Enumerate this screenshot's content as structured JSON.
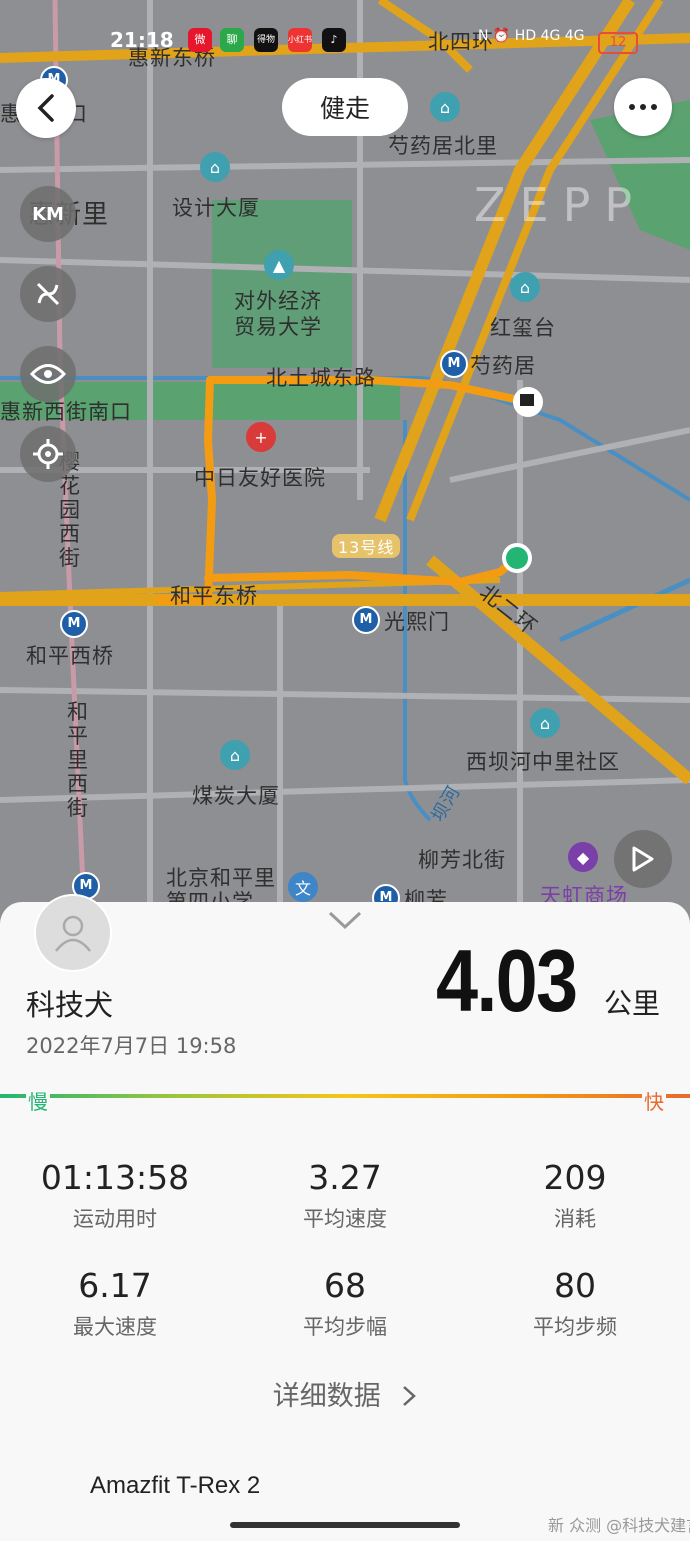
{
  "status_bar": {
    "time": "21:18",
    "apps": [
      "微",
      "聊",
      "得物",
      "小红书",
      "♪"
    ],
    "system": "N ⏰ HD 4G 4G",
    "battery": "12"
  },
  "map": {
    "watermark": "ZEPP",
    "labels": {
      "huixin_dongqiao": "惠新东桥",
      "beisihuan": "北四环",
      "huixin_beikou": "惠新北口",
      "huixin_li": "惠新里",
      "shaoyaoju_beili": "芍药居北里",
      "sheji_dasha": "设计大厦",
      "uibe": "对外经济\n贸易大学",
      "hongxi_tai": "红玺台",
      "shaoyaoju": "芍药居",
      "beitucheng_donglu": "北土城东路",
      "huixin_xijie_nankou": "惠新西街南口",
      "yinghua_yuan_xijie": "樱花园西街",
      "zhongri_hospital": "中日友好医院",
      "line13": "13号线",
      "heping_dongqiao": "和平东桥",
      "guangximen": "光熙门",
      "beierhuan": "北二环",
      "heping_xiqiao": "和平西桥",
      "heping_li_xijie": "和平里西街",
      "meitan_dasha": "煤炭大厦",
      "xibahe": "西坝河中里社区",
      "bahe": "坝河",
      "liufang_beijie": "柳芳北街",
      "beijing_hepingli": "北京和平里\n第四小学",
      "liufang": "柳芳",
      "tianhong": "天虹商场"
    }
  },
  "controls": {
    "mode": "健走",
    "km_icon": "KM"
  },
  "workout": {
    "username": "科技犬",
    "datetime": "2022年7月7日 19:58",
    "distance": "4.03",
    "distance_unit": "公里",
    "slow_label": "慢",
    "fast_label": "快",
    "stats": [
      {
        "value": "01:13:58",
        "label": "运动用时"
      },
      {
        "value": "3.27",
        "label": "平均速度"
      },
      {
        "value": "209",
        "label": "消耗"
      },
      {
        "value": "6.17",
        "label": "最大速度"
      },
      {
        "value": "68",
        "label": "平均步幅"
      },
      {
        "value": "80",
        "label": "平均步频"
      }
    ],
    "detail_link": "详细数据",
    "device": "Amazfit T-Rex 2",
    "watermark": "新 众测 @科技犬建言"
  },
  "colors": {
    "route": "#f39c12",
    "start": "#22b573",
    "road": "#e0a31a",
    "green_area": "#5aa26f"
  }
}
